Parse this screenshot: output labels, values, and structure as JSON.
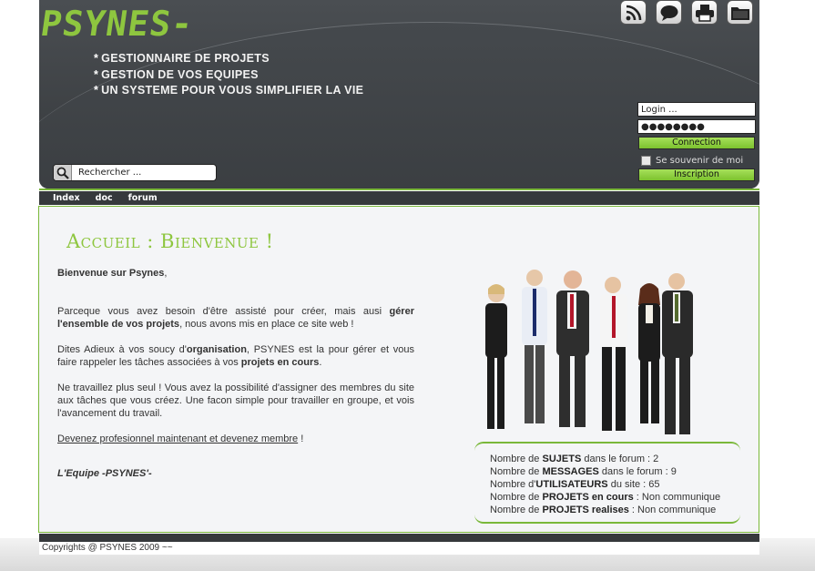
{
  "header": {
    "logo_text": "PSYNES-",
    "taglines": [
      "GESTIONNAIRE DE PROJETS",
      "GESTION DE VOS EQUIPES",
      "UN SYSTEME POUR VOUS SIMPLIFIER LA VIE"
    ],
    "icons": [
      "rss-icon",
      "chat-bubble-icon",
      "printer-icon",
      "folder-icon"
    ]
  },
  "search": {
    "placeholder": "Rechercher ..."
  },
  "login": {
    "login_value": "Login ...",
    "password_value": "●●●●●●●●",
    "connect_label": "Connection",
    "remember_label": "Se souvenir de moi",
    "register_label": "Inscription"
  },
  "nav": {
    "items": [
      "Index",
      "doc",
      "forum"
    ]
  },
  "main": {
    "title": "Accueil : Bienvenue !",
    "welcome_pre": "Bienvenue sur ",
    "welcome_name": "Psynes",
    "welcome_post": ",",
    "p1_a": "Parceque vous avez besoin d'être assisté pour créer, mais ausi ",
    "p1_b": "gérer l'ensemble de vos projets",
    "p1_c": ", nous avons mis en place ce site web !",
    "p2_a": "Dites Adieux à vos soucy d'",
    "p2_b": "organisation",
    "p2_c": ", PSYNES est la pour gérer et vous faire rappeler les tâches associées à vos ",
    "p2_d": "projets en cours",
    "p2_e": ".",
    "p3": "Ne travaillez plus seul ! Vous avez la possibilité d'assigner des membres du site aux tâches que vous créez. Une facon simple pour travailler en groupe, et vois l'avancement du travail.",
    "cta_link": "Devenez profesionnel maintenant et devenez membre",
    "cta_tail": " !",
    "signature": "L'Equipe -PSYNES'-"
  },
  "stats": [
    {
      "pre": "Nombre de ",
      "bold": "SUJETS",
      "post": " dans le forum : 2"
    },
    {
      "pre": "Nombre de ",
      "bold": "MESSAGES",
      "post": " dans le forum : 9"
    },
    {
      "pre": "Nombre d'",
      "bold": "UTILISATEURS",
      "post": " du site : 65"
    },
    {
      "pre": "Nombre de ",
      "bold": "PROJETS en cours",
      "post": " : Non communique"
    },
    {
      "pre": "Nombre de ",
      "bold": "PROJETS realises",
      "post": " : Non communique"
    }
  ],
  "footer": {
    "copyright": "Copyrights @ PSYNES 2009 ~~"
  },
  "colors": {
    "accent_green": "#8ec63f",
    "header_dark": "#3a3d40"
  }
}
